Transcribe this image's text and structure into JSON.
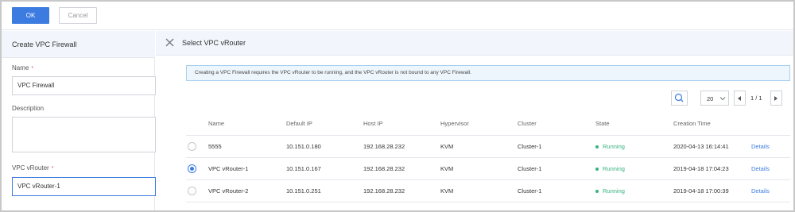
{
  "toolbar": {
    "ok_label": "OK",
    "cancel_label": "Cancel"
  },
  "left": {
    "title": "Create VPC Firewall",
    "name_label": "Name",
    "name_value": "VPC Firewall",
    "description_label": "Description",
    "description_value": "",
    "vrouter_label": "VPC vRouter",
    "vrouter_value": "VPC vRouter-1",
    "required_mark": "*"
  },
  "right": {
    "title": "Select VPC vRouter",
    "info": "Creating a VPC Firewall requires the VPC vRouter to be running, and the VPC vRouter is not bound to any VPC Firewall.",
    "page_size": "20",
    "page_indicator": "1 / 1"
  },
  "table": {
    "columns": [
      "Name",
      "Default IP",
      "Host IP",
      "Hypervisor",
      "Cluster",
      "State",
      "Creation Time"
    ],
    "rows": [
      {
        "selected": false,
        "name": "5555",
        "default_ip": "10.151.0.180",
        "host_ip": "192.168.28.232",
        "hypervisor": "KVM",
        "cluster": "Cluster-1",
        "state": "Running",
        "created": "2020-04-13 16:14:41",
        "action": "Details"
      },
      {
        "selected": true,
        "name": "VPC vRouter-1",
        "default_ip": "10.151.0.167",
        "host_ip": "192.168.28.232",
        "hypervisor": "KVM",
        "cluster": "Cluster-1",
        "state": "Running",
        "created": "2019-04-18 17:04:23",
        "action": "Details"
      },
      {
        "selected": false,
        "name": "VPC vRouter-2",
        "default_ip": "10.151.0.251",
        "host_ip": "192.168.28.232",
        "hypervisor": "KVM",
        "cluster": "Cluster-1",
        "state": "Running",
        "created": "2019-04-18 17:00:39",
        "action": "Details"
      }
    ]
  },
  "colors": {
    "accent": "#3c7ce0",
    "running": "#36b37e",
    "header_bg": "#f2f6fc",
    "info_bg": "#eef6fd"
  },
  "icons": {
    "close": "close-icon",
    "search": "search-icon",
    "dropdown": "chevron-down-icon",
    "prev": "prev-page-icon",
    "next": "next-page-icon"
  }
}
